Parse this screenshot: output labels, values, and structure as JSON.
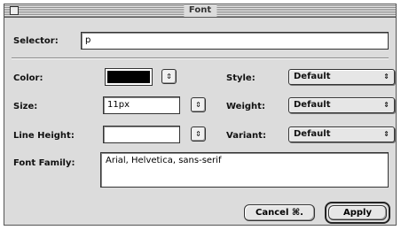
{
  "window": {
    "title": "Font"
  },
  "selector": {
    "label": "Selector:",
    "value": "p"
  },
  "color": {
    "label": "Color:",
    "swatch": "#000000",
    "stepper": "⇕"
  },
  "size": {
    "label": "Size:",
    "value": "11px",
    "stepper": "⇕"
  },
  "line_height": {
    "label": "Line Height:",
    "value": "",
    "stepper": "⇕"
  },
  "style": {
    "label": "Style:",
    "value": "Default",
    "arrows": "⇕"
  },
  "weight": {
    "label": "Weight:",
    "value": "Default",
    "arrows": "⇕"
  },
  "variant": {
    "label": "Variant:",
    "value": "Default",
    "arrows": "⇕"
  },
  "font_family": {
    "label": "Font Family:",
    "value": "Arial, Helvetica, sans-serif"
  },
  "buttons": {
    "cancel": "Cancel ⌘.",
    "apply": "Apply"
  }
}
